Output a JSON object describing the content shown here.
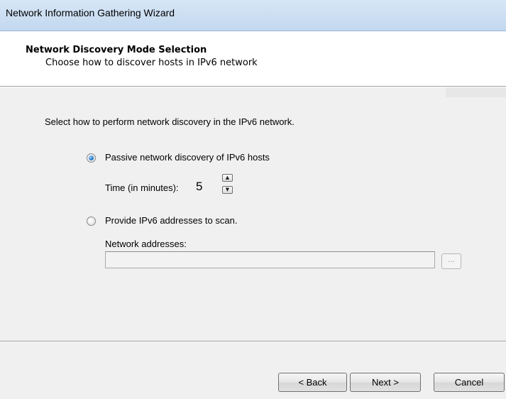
{
  "window": {
    "title": "Network Information Gathering Wizard"
  },
  "header": {
    "title": "Network Discovery Mode Selection",
    "subtitle": "Choose how to discover hosts in IPv6 network"
  },
  "content": {
    "instruction": "Select how to perform network discovery in the IPv6 network.",
    "options": [
      {
        "label": "Passive network discovery of IPv6 hosts",
        "selected": true
      },
      {
        "label": "Provide IPv6 addresses to scan.",
        "selected": false
      }
    ],
    "time": {
      "label": "Time (in minutes):",
      "value": "5",
      "up_icon": "arrow-up-icon",
      "down_icon": "arrow-down-icon"
    },
    "addresses": {
      "label": "Network addresses:",
      "value": "",
      "browse_label": "..."
    }
  },
  "buttons": {
    "back": "< Back",
    "next": "Next >",
    "cancel": "Cancel"
  },
  "colors": {
    "title_bar": "#c9dcf1",
    "content_bg": "#f0f0f0",
    "radio_selected": "#2b79c9"
  }
}
